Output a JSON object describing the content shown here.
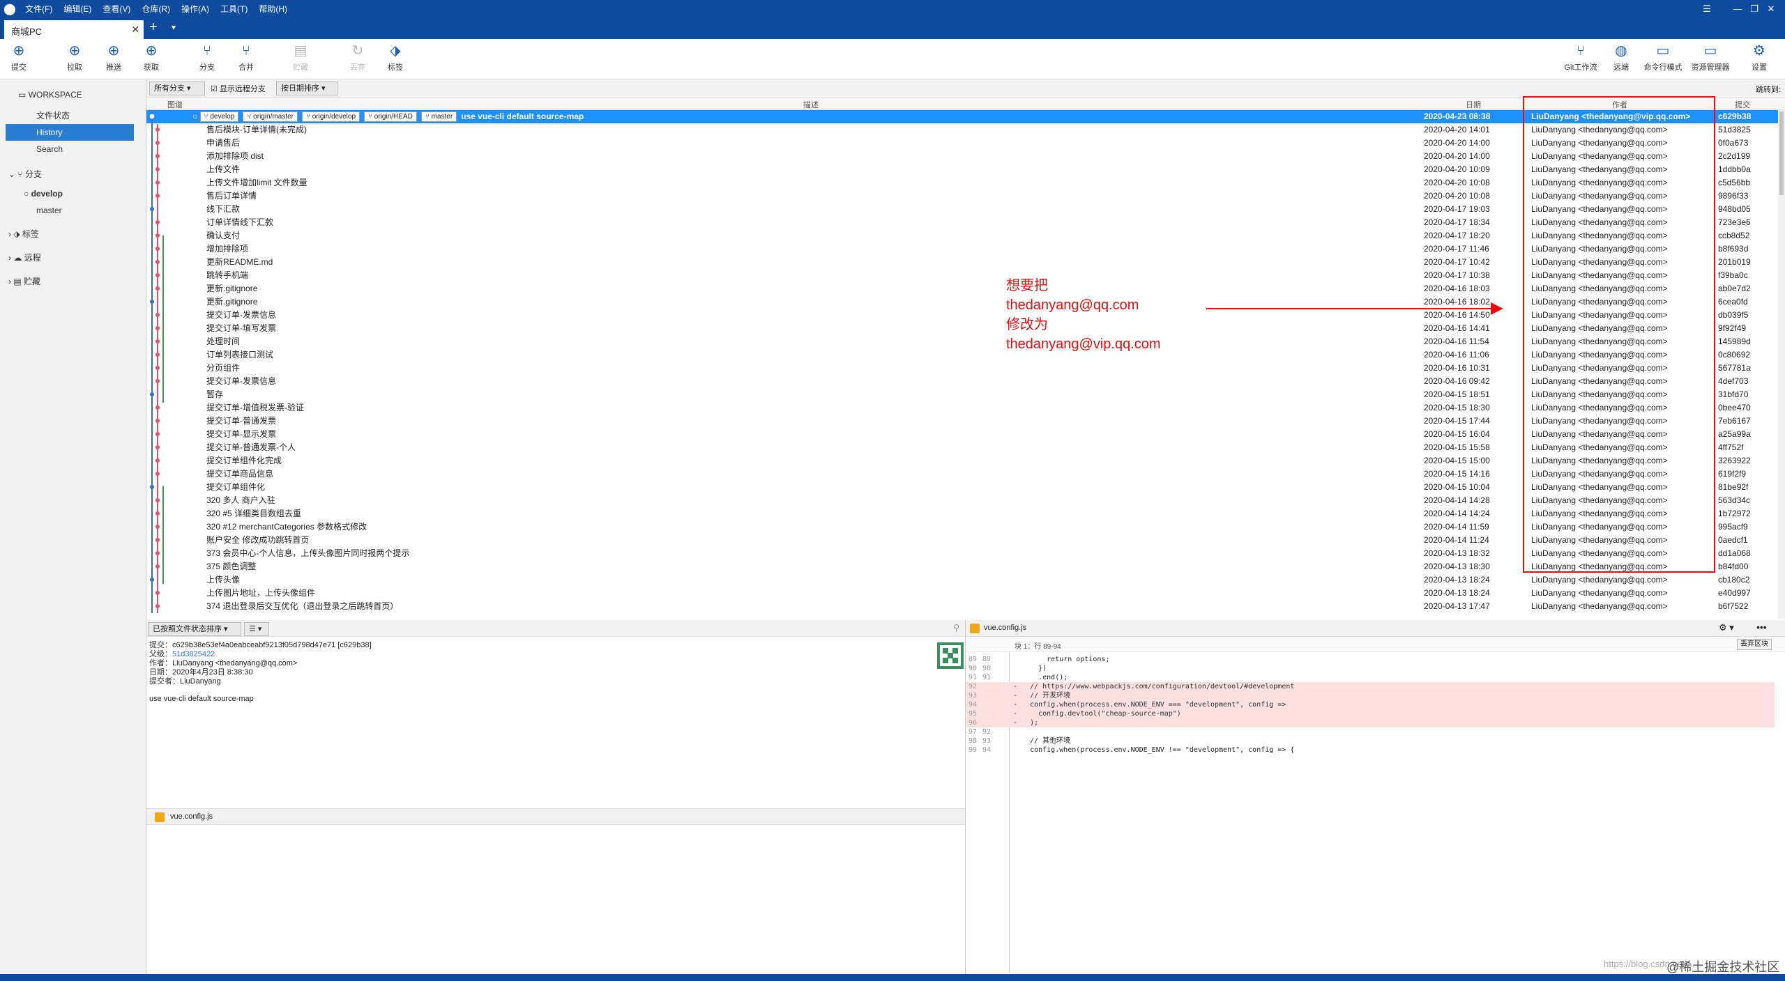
{
  "menubar": {
    "items": [
      "文件(F)",
      "编辑(E)",
      "查看(V)",
      "仓库(R)",
      "操作(A)",
      "工具(T)",
      "帮助(H)"
    ]
  },
  "tab": {
    "title": "商城PC"
  },
  "toolbar": {
    "left": [
      {
        "label": "提交",
        "icon": "plus-circle-icon"
      },
      {
        "label": "拉取",
        "icon": "arrow-down-circle-icon"
      },
      {
        "label": "推送",
        "icon": "arrow-up-circle-icon"
      },
      {
        "label": "获取",
        "icon": "fetch-icon"
      },
      {
        "label": "分支",
        "icon": "branch-icon"
      },
      {
        "label": "合并",
        "icon": "merge-icon"
      },
      {
        "label": "贮藏",
        "icon": "stash-icon"
      },
      {
        "label": "丢弃",
        "icon": "discard-icon"
      },
      {
        "label": "标签",
        "icon": "tag-icon"
      }
    ],
    "right": [
      {
        "label": "Git工作流",
        "icon": "git-flow-icon"
      },
      {
        "label": "远端",
        "icon": "globe-icon"
      },
      {
        "label": "命令行模式",
        "icon": "terminal-icon"
      },
      {
        "label": "资源管理器",
        "icon": "folder-icon"
      },
      {
        "label": "设置",
        "icon": "gear-icon"
      }
    ]
  },
  "sidebar": {
    "workspace": "WORKSPACE",
    "file_status": "文件状态",
    "history": "History",
    "search": "Search",
    "branches": "分支",
    "branch_items": [
      "develop",
      "master"
    ],
    "tags": "标签",
    "remotes": "远程",
    "stashes": "贮藏"
  },
  "filterbar": {
    "branches": "所有分支",
    "show_remote": "显示远程分支",
    "sort": "按日期排序",
    "jump": "跳转到:"
  },
  "columns": {
    "graph": "图谱",
    "desc": "描述",
    "date": "日期",
    "author": "作者",
    "commit": "提交"
  },
  "commits": [
    {
      "desc": "use vue-cli default source-map",
      "date": "2020-04-23 08:38",
      "author": "LiuDanyang <thedanyang@vip.qq.com>",
      "hash": "c629b38",
      "refs": [
        "develop",
        "origin/master",
        "origin/develop",
        "origin/HEAD",
        "master"
      ]
    },
    {
      "desc": "售后模块-订单详情(未完成)",
      "date": "2020-04-20 14:01",
      "author": "LiuDanyang <thedanyang@qq.com>",
      "hash": "51d3825"
    },
    {
      "desc": "申请售后",
      "date": "2020-04-20 14:00",
      "author": "LiuDanyang <thedanyang@qq.com>",
      "hash": "0f0a673"
    },
    {
      "desc": "添加排除项 dist",
      "date": "2020-04-20 14:00",
      "author": "LiuDanyang <thedanyang@qq.com>",
      "hash": "2c2d199"
    },
    {
      "desc": "上传文件",
      "date": "2020-04-20 10:09",
      "author": "LiuDanyang <thedanyang@qq.com>",
      "hash": "1ddbb0a"
    },
    {
      "desc": "上传文件增加limit 文件数量",
      "date": "2020-04-20 10:08",
      "author": "LiuDanyang <thedanyang@qq.com>",
      "hash": "c5d56bb"
    },
    {
      "desc": "售后订单详情",
      "date": "2020-04-20 10:08",
      "author": "LiuDanyang <thedanyang@qq.com>",
      "hash": "9896f33"
    },
    {
      "desc": "线下汇款",
      "date": "2020-04-17 19:03",
      "author": "LiuDanyang <thedanyang@qq.com>",
      "hash": "948bd05"
    },
    {
      "desc": "订单详情线下汇款",
      "date": "2020-04-17 18:34",
      "author": "LiuDanyang <thedanyang@qq.com>",
      "hash": "723e3e6"
    },
    {
      "desc": "确认支付",
      "date": "2020-04-17 18:20",
      "author": "LiuDanyang <thedanyang@qq.com>",
      "hash": "ccb8d52"
    },
    {
      "desc": "增加排除项",
      "date": "2020-04-17 11:46",
      "author": "LiuDanyang <thedanyang@qq.com>",
      "hash": "b8f693d"
    },
    {
      "desc": "更新README.md",
      "date": "2020-04-17 10:42",
      "author": "LiuDanyang <thedanyang@qq.com>",
      "hash": "201b019"
    },
    {
      "desc": "跳转手机端",
      "date": "2020-04-17 10:38",
      "author": "LiuDanyang <thedanyang@qq.com>",
      "hash": "f39ba0c"
    },
    {
      "desc": "更新.gitignore",
      "date": "2020-04-16 18:03",
      "author": "LiuDanyang <thedanyang@qq.com>",
      "hash": "ab0e7d2"
    },
    {
      "desc": "更新.gitignore",
      "date": "2020-04-16 18:02",
      "author": "LiuDanyang <thedanyang@qq.com>",
      "hash": "6cea0fd"
    },
    {
      "desc": "提交订单-发票信息",
      "date": "2020-04-16 14:50",
      "author": "LiuDanyang <thedanyang@qq.com>",
      "hash": "db039f5"
    },
    {
      "desc": "提交订单-填写发票",
      "date": "2020-04-16 14:41",
      "author": "LiuDanyang <thedanyang@qq.com>",
      "hash": "9f92f49"
    },
    {
      "desc": "处理时间",
      "date": "2020-04-16 11:54",
      "author": "LiuDanyang <thedanyang@qq.com>",
      "hash": "145989d"
    },
    {
      "desc": "订单列表接口测试",
      "date": "2020-04-16 11:06",
      "author": "LiuDanyang <thedanyang@qq.com>",
      "hash": "0c80692"
    },
    {
      "desc": "分页组件",
      "date": "2020-04-16 10:31",
      "author": "LiuDanyang <thedanyang@qq.com>",
      "hash": "567781a"
    },
    {
      "desc": "提交订单-发票信息",
      "date": "2020-04-16 09:42",
      "author": "LiuDanyang <thedanyang@qq.com>",
      "hash": "4def703"
    },
    {
      "desc": "暂存",
      "date": "2020-04-15 18:51",
      "author": "LiuDanyang <thedanyang@qq.com>",
      "hash": "31bfd70"
    },
    {
      "desc": "提交订单-增值税发票-验证",
      "date": "2020-04-15 18:30",
      "author": "LiuDanyang <thedanyang@qq.com>",
      "hash": "0bee470"
    },
    {
      "desc": "提交订单-普通发票",
      "date": "2020-04-15 17:44",
      "author": "LiuDanyang <thedanyang@qq.com>",
      "hash": "7eb6167"
    },
    {
      "desc": "提交订单-显示发票",
      "date": "2020-04-15 16:04",
      "author": "LiuDanyang <thedanyang@qq.com>",
      "hash": "a25a99a"
    },
    {
      "desc": "提交订单-普通发票-个人",
      "date": "2020-04-15 15:58",
      "author": "LiuDanyang <thedanyang@qq.com>",
      "hash": "4ff752f"
    },
    {
      "desc": "提交订单组件化完成",
      "date": "2020-04-15 15:00",
      "author": "LiuDanyang <thedanyang@qq.com>",
      "hash": "3263922"
    },
    {
      "desc": "提交订单商品信息",
      "date": "2020-04-15 14:16",
      "author": "LiuDanyang <thedanyang@qq.com>",
      "hash": "619f2f9"
    },
    {
      "desc": "提交订单组件化",
      "date": "2020-04-15 10:04",
      "author": "LiuDanyang <thedanyang@qq.com>",
      "hash": "81be92f"
    },
    {
      "desc": "320 多人 商户入驻",
      "date": "2020-04-14 14:28",
      "author": "LiuDanyang <thedanyang@qq.com>",
      "hash": "563d34c"
    },
    {
      "desc": "320 #5 详细类目数组去重",
      "date": "2020-04-14 14:24",
      "author": "LiuDanyang <thedanyang@qq.com>",
      "hash": "1b72972"
    },
    {
      "desc": "320 #12 merchantCategories 参数格式修改",
      "date": "2020-04-14 11:59",
      "author": "LiuDanyang <thedanyang@qq.com>",
      "hash": "995acf9"
    },
    {
      "desc": "账户安全 修改成功跳转首页",
      "date": "2020-04-14 11:24",
      "author": "LiuDanyang <thedanyang@qq.com>",
      "hash": "0aedcf1"
    },
    {
      "desc": "373 会员中心-个人信息，上传头像图片同时报两个提示",
      "date": "2020-04-13 18:32",
      "author": "LiuDanyang <thedanyang@qq.com>",
      "hash": "dd1a068"
    },
    {
      "desc": "375 颜色调整",
      "date": "2020-04-13 18:30",
      "author": "LiuDanyang <thedanyang@qq.com>",
      "hash": "b84fd00"
    },
    {
      "desc": "上传头像",
      "date": "2020-04-13 18:24",
      "author": "LiuDanyang <thedanyang@qq.com>",
      "hash": "cb180c2"
    },
    {
      "desc": "上传图片地址，上传头像组件",
      "date": "2020-04-13 18:24",
      "author": "LiuDanyang <thedanyang@qq.com>",
      "hash": "e40d997"
    },
    {
      "desc": "374 退出登录后交互优化（退出登录之后跳转首页）",
      "date": "2020-04-13 17:47",
      "author": "LiuDanyang <thedanyang@qq.com>",
      "hash": "b6f7522"
    }
  ],
  "annotation": {
    "line1": "想要把",
    "line2": "thedanyang@qq.com",
    "line3": "修改为",
    "line4": "thedanyang@vip.qq.com",
    "color": "#e01010"
  },
  "bottombar": {
    "sort": "已按照文件状态排序"
  },
  "details": {
    "commit_label": "提交：",
    "commit_value": "c629b38e53ef4a0eabceabf9213f05d798d47e71 [c629b38]",
    "parent_label": "父级：",
    "parent_value": "51d3825422",
    "author_label": "作者：",
    "author_value": "LiuDanyang <thedanyang@qq.com>",
    "date_label": "日期：",
    "date_value": "2020年4月23日 8:38:30",
    "committer_label": "提交者：",
    "committer_value": "LiuDanyang",
    "message": "use vue-cli default source-map"
  },
  "file": {
    "name": "vue.config.js"
  },
  "diff": {
    "file": "vue.config.js",
    "hunk": "块 1：行 89-94",
    "discard": "丢弃区块",
    "lines": [
      {
        "o": "89",
        "n": "89",
        "t": "        return options;",
        "k": "ctx"
      },
      {
        "o": "90",
        "n": "90",
        "t": "      })",
        "k": "ctx"
      },
      {
        "o": "91",
        "n": "91",
        "t": "      .end();",
        "k": "ctx"
      },
      {
        "o": "92",
        "n": "",
        "t": "-   // https://www.webpackjs.com/configuration/devtool/#development",
        "k": "rm"
      },
      {
        "o": "93",
        "n": "",
        "t": "-   // 开发环境",
        "k": "rm"
      },
      {
        "o": "94",
        "n": "",
        "t": "-   config.when(process.env.NODE_ENV === \"development\", config =>",
        "k": "rm"
      },
      {
        "o": "95",
        "n": "",
        "t": "-     config.devtool(\"cheap-source-map\")",
        "k": "rm"
      },
      {
        "o": "96",
        "n": "",
        "t": "-   );",
        "k": "rm"
      },
      {
        "o": "97",
        "n": "92",
        "t": "",
        "k": "ctx"
      },
      {
        "o": "98",
        "n": "93",
        "t": "    // 其他环境",
        "k": "ctx"
      },
      {
        "o": "99",
        "n": "94",
        "t": "    config.when(process.env.NODE_ENV !== \"development\", config => {",
        "k": "ctx"
      }
    ]
  },
  "watermark": "https://blog.csdn.net/...",
  "watermark2": "@稀土掘金技术社区"
}
